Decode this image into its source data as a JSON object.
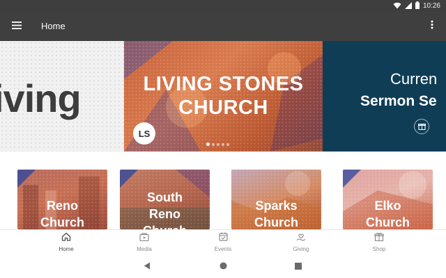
{
  "status_bar": {
    "time": "10:26",
    "icons": [
      "wifi-icon",
      "signal-icon",
      "battery-icon"
    ]
  },
  "app_bar": {
    "title": "Home",
    "icons": [
      "menu-icon",
      "more-vert-icon"
    ]
  },
  "carousel": {
    "slides": [
      {
        "partial_text": "iving"
      },
      {
        "title_line_1": "LIVING STONES",
        "title_line_2": "CHURCH",
        "logo_text": "LS"
      },
      {
        "subtitle_line_1": "Curren",
        "subtitle_line_2": "Sermon Se"
      }
    ],
    "active_index": 0,
    "dot_count": 5
  },
  "churches": [
    {
      "line1": "Reno",
      "line2": "Church"
    },
    {
      "line1": "South",
      "line2": "Reno",
      "line3": "Church"
    },
    {
      "line1": "Sparks",
      "line2": "Church"
    },
    {
      "line1": "Elko",
      "line2": "Church"
    }
  ],
  "bottom_nav": {
    "items": [
      {
        "label": "Home",
        "icon": "home-icon",
        "active": true
      },
      {
        "label": "Media",
        "icon": "media-icon",
        "active": false
      },
      {
        "label": "Events",
        "icon": "calendar-icon",
        "active": false
      },
      {
        "label": "Giving",
        "icon": "giving-icon",
        "active": false
      },
      {
        "label": "Shop",
        "icon": "shop-icon",
        "active": false
      }
    ]
  },
  "system_nav": {
    "icons": [
      "back-icon",
      "home-circle-icon",
      "recents-icon"
    ]
  },
  "colors": {
    "app_bar": "#3f3f3f",
    "status_bar": "#3e3e3e",
    "sermon_slide": "#0f3d55",
    "nav_label": "#8a8a8a"
  }
}
